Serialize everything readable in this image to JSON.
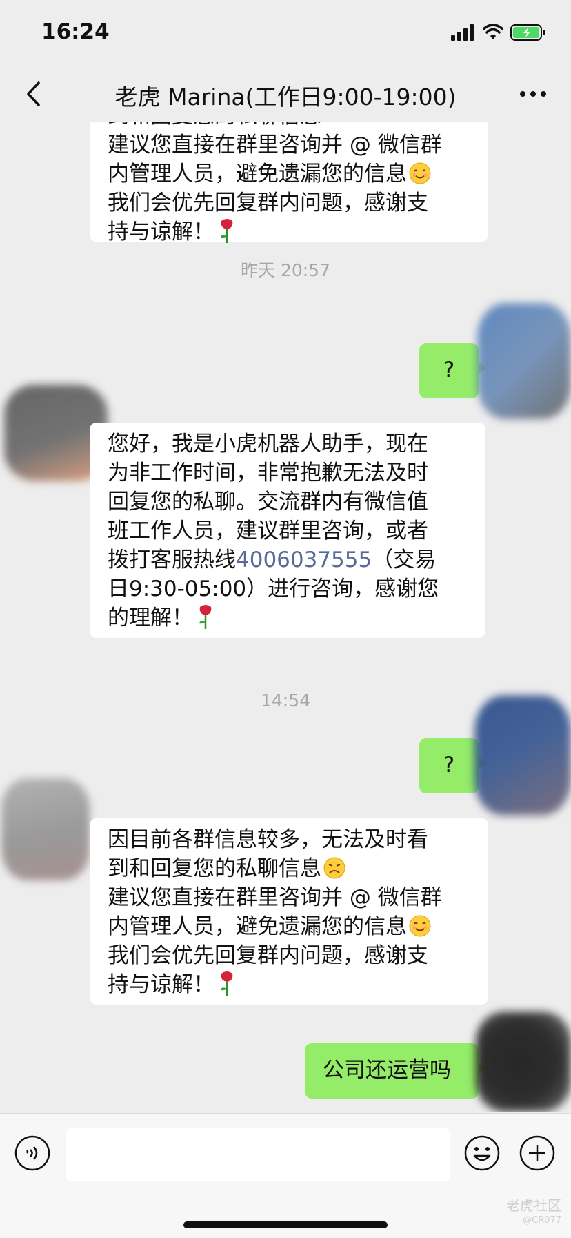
{
  "status_bar": {
    "time": "16:24"
  },
  "nav": {
    "title": "老虎 Marina(工作日9:00-19:00)"
  },
  "messages": {
    "m1": {
      "lines": [
        "到和回复您的私聊信息",
        "建议您直接在群里咨询并 @ 微信群",
        "内管理人员，避免遗漏您的信息",
        "我们会优先回复群内问题，感谢支",
        "持与谅解！"
      ]
    },
    "ts1": "昨天 20:57",
    "m2": "?",
    "m3": {
      "lines": [
        "您好，我是小虎机器人助手，现在",
        "为非工作时间，非常抱歉无法及时",
        "回复您的私聊。交流群内有微信值",
        "班工作人员，建议群里咨询，或者"
      ],
      "line5_prefix": "拨打客服热线",
      "phone": "4006037555",
      "line5_suffix": "（交易",
      "line6": "日9:30-05:00）进行咨询，感谢您",
      "line7": "的理解！"
    },
    "ts2": "14:54",
    "m4": "?",
    "m5": {
      "lines": [
        "因目前各群信息较多，无法及时看",
        "到和回复您的私聊信息",
        "建议您直接在群里咨询并 @ 微信群",
        "内管理人员，避免遗漏您的信息",
        "我们会优先回复群内问题，感谢支",
        "持与谅解！"
      ]
    },
    "m6": "公司还运营吗"
  },
  "input": {
    "placeholder": ""
  },
  "watermark": {
    "brand": "老虎社区",
    "handle": "@CR077"
  },
  "colors": {
    "background": "#ededed",
    "my_bubble": "#95ec69",
    "other_bubble": "#ffffff",
    "link": "#576b95"
  },
  "icons": [
    "back-icon",
    "more-icon",
    "signal-icon",
    "wifi-icon",
    "battery-icon",
    "voice-icon",
    "emoji-icon",
    "plus-icon",
    "rose-emoji",
    "smile-emoji",
    "sad-emoji"
  ]
}
